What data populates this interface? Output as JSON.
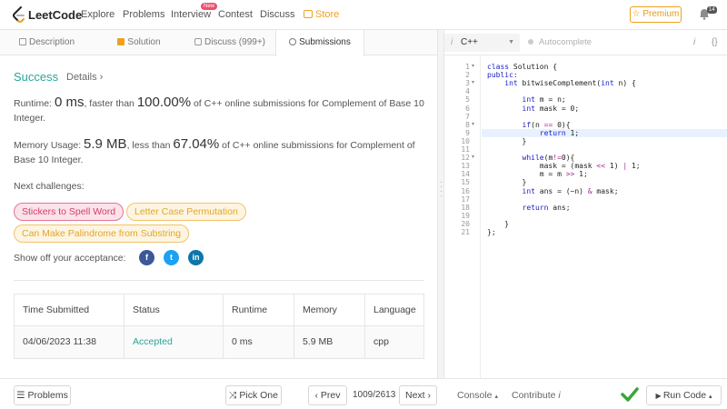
{
  "nav": {
    "logo": "LeetCode",
    "items": [
      "Explore",
      "Problems",
      "Interview",
      "Contest",
      "Discuss"
    ],
    "interview_badge": "New",
    "store": "Store",
    "premium": "☆ Premium",
    "notif_count": "14"
  },
  "tabs": [
    "Description",
    "Solution",
    "Discuss (999+)",
    "Submissions"
  ],
  "result": {
    "status": "Success",
    "details": "Details ›",
    "runtime_label": "Runtime:",
    "runtime_value": "0 ms",
    "runtime_mid": ", faster than",
    "runtime_pct": "100.00%",
    "runtime_tail": "of C++ online submissions for Complement of Base 10 Integer.",
    "memory_label": "Memory Usage:",
    "memory_value": "5.9 MB",
    "memory_mid": ", less than",
    "memory_pct": "67.04%",
    "memory_tail": "of C++ online submissions for Complement of Base 10 Integer.",
    "next_label": "Next challenges:",
    "challenges": [
      "Stickers to Spell Word",
      "Letter Case Permutation",
      "Can Make Palindrome from Substring"
    ],
    "share_label": "Show off your acceptance:"
  },
  "table": {
    "headers": [
      "Time Submitted",
      "Status",
      "Runtime",
      "Memory",
      "Language"
    ],
    "rows": [
      [
        "04/06/2023 11:38",
        "Accepted",
        "0 ms",
        "5.9 MB",
        "cpp"
      ]
    ]
  },
  "editor": {
    "language": "C++",
    "autocomplete": "Autocomplete",
    "info_icon": "i",
    "braces_icon": "{}",
    "line_numbers": [
      "1",
      "2",
      "3",
      "4",
      "5",
      "6",
      "7",
      "8",
      "9",
      "10",
      "11",
      "12",
      "13",
      "14",
      "15",
      "16",
      "17",
      "18",
      "19",
      "20",
      "21"
    ],
    "code": [
      "class Solution {",
      "public:",
      "    int bitwiseComplement(int n) {",
      "",
      "        int m = n;",
      "        int mask = 0;",
      "",
      "        if(n == 0){",
      "            return 1;",
      "        }",
      "",
      "        while(m!=0){",
      "            mask = (mask << 1) | 1;",
      "            m = m >> 1;",
      "        }",
      "        int ans = (~n) & mask;",
      "",
      "        return ans;",
      "",
      "    }",
      "};"
    ]
  },
  "bottom": {
    "problems": "Problems",
    "pick_one": "Pick One",
    "prev": "‹ Prev",
    "page": "1009/2613",
    "next": "Next ›",
    "console": "Console",
    "contribute": "Contribute",
    "run_code": "Run Code"
  }
}
